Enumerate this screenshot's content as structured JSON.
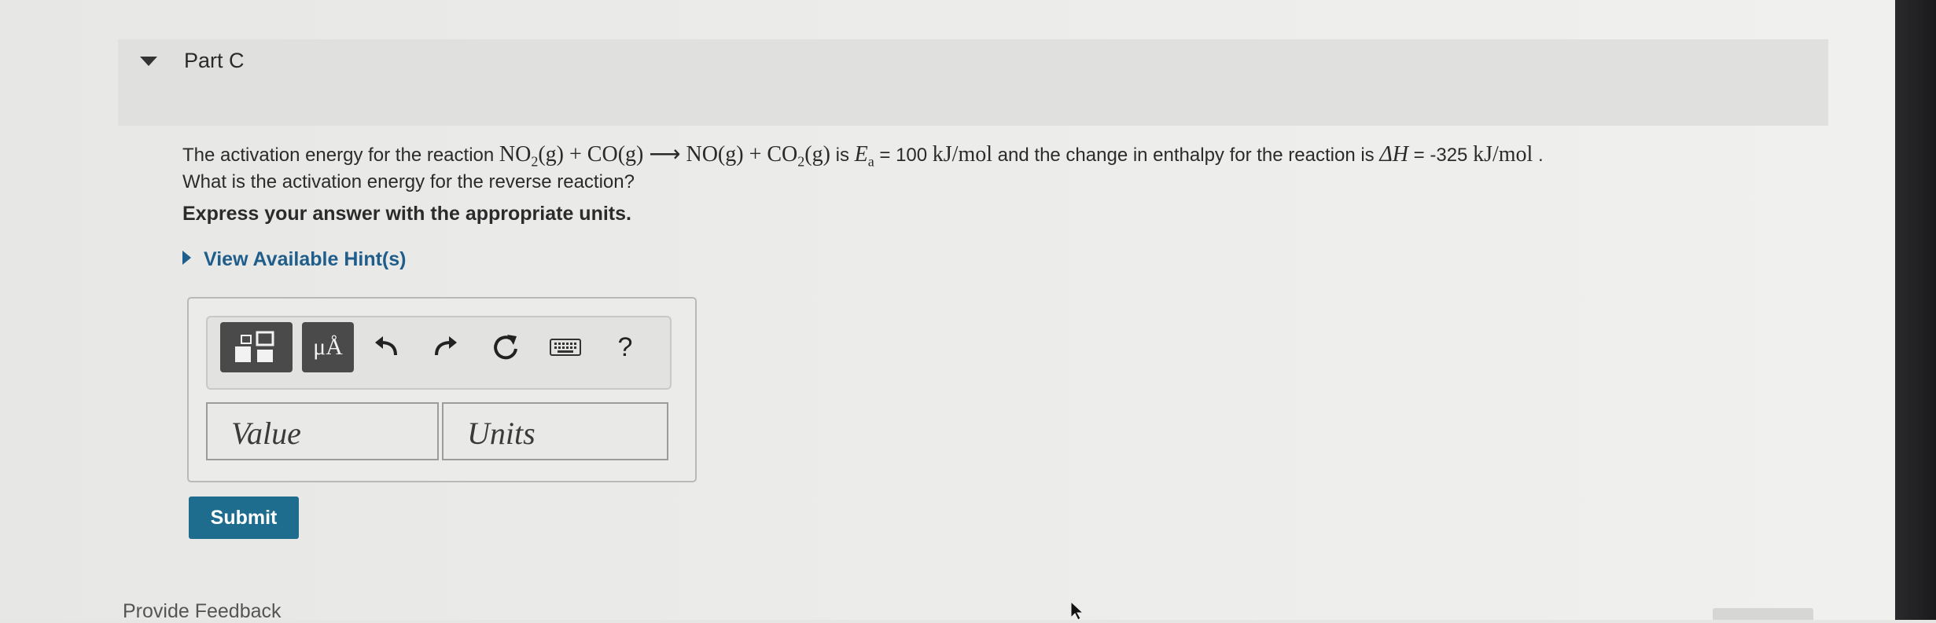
{
  "part": {
    "title": "Part C"
  },
  "question": {
    "intro": "The activation energy for the reaction ",
    "reaction": {
      "r1": "NO",
      "r1_sub": "2",
      "r1_state": "(g)",
      "plus1": " + ",
      "r2": "CO(g)",
      "arrow": " ⟶ ",
      "p1": "NO(g)",
      "plus2": " + ",
      "p2": "CO",
      "p2_sub": "2",
      "p2_state": "(g)"
    },
    "is_text": " is ",
    "ea_symbol": "E",
    "ea_sub": "a",
    "ea_value": " = 100 ",
    "ea_unit": "kJ/mol",
    "mid_text": " and the change in enthalpy for the reaction is ",
    "dh_symbol": "ΔH",
    "dh_value": " = -325 ",
    "dh_unit": "kJ/mol",
    "end": " .",
    "line2": "What is the activation energy for the reverse reaction?"
  },
  "instruction": "Express your answer with the appropriate units.",
  "hints_label": "View Available Hint(s)",
  "toolbar": {
    "units_label": "μÅ",
    "help_label": "?"
  },
  "answer": {
    "value_placeholder": "Value",
    "units_placeholder": "Units"
  },
  "submit_label": "Submit",
  "feedback_label": "Provide Feedback"
}
